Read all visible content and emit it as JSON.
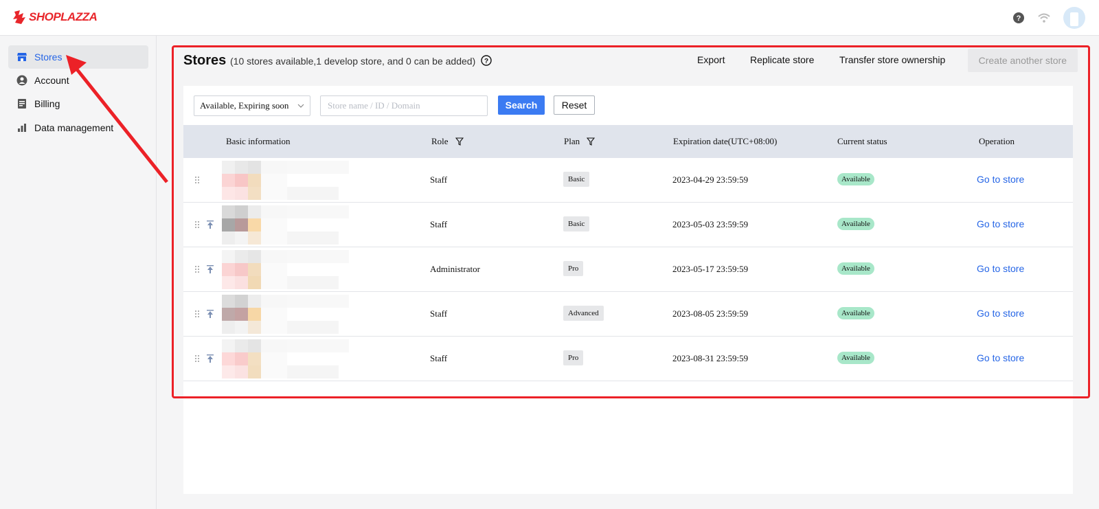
{
  "header": {
    "logo_text": "SHOPLAZZA",
    "icons": [
      "help-icon",
      "wifi-icon",
      "avatar"
    ]
  },
  "sidebar": {
    "items": [
      {
        "label": "Stores",
        "icon": "store-icon",
        "active": true
      },
      {
        "label": "Account",
        "icon": "user-icon",
        "active": false
      },
      {
        "label": "Billing",
        "icon": "document-icon",
        "active": false
      },
      {
        "label": "Data management",
        "icon": "bar-chart-icon",
        "active": false
      }
    ]
  },
  "page": {
    "title": "Stores",
    "subtitle": "(10 stores available,1 develop store, and 0 can be added)",
    "actions": {
      "export": "Export",
      "replicate": "Replicate store",
      "transfer": "Transfer store ownership",
      "create": "Create another store"
    }
  },
  "filters": {
    "status_value": "Available, Expiring soon",
    "search_placeholder": "Store name / ID / Domain",
    "search_button": "Search",
    "reset_button": "Reset"
  },
  "table": {
    "columns": {
      "basic": "Basic information",
      "role": "Role",
      "plan": "Plan",
      "expiration": "Expiration date(UTC+08:00)",
      "status": "Current status",
      "operation": "Operation"
    },
    "rows": [
      {
        "role": "Staff",
        "plan": "Basic",
        "expiration": "2023-04-29 23:59:59",
        "status": "Available",
        "operation": "Go to store",
        "pinned": false
      },
      {
        "role": "Staff",
        "plan": "Basic",
        "expiration": "2023-05-03 23:59:59",
        "status": "Available",
        "operation": "Go to store",
        "pinned": true
      },
      {
        "role": "Administrator",
        "plan": "Pro",
        "expiration": "2023-05-17 23:59:59",
        "status": "Available",
        "operation": "Go to store",
        "pinned": true
      },
      {
        "role": "Staff",
        "plan": "Advanced",
        "expiration": "2023-08-05 23:59:59",
        "status": "Available",
        "operation": "Go to store",
        "pinned": true
      },
      {
        "role": "Staff",
        "plan": "Pro",
        "expiration": "2023-08-31 23:59:59",
        "status": "Available",
        "operation": "Go to store",
        "pinned": true
      }
    ]
  },
  "colors": {
    "accent": "#2565e6",
    "primary_button": "#3b7bf2",
    "status_available": "#a8e7c9",
    "annotation": "#ec2127",
    "brand": "#e8262b"
  }
}
